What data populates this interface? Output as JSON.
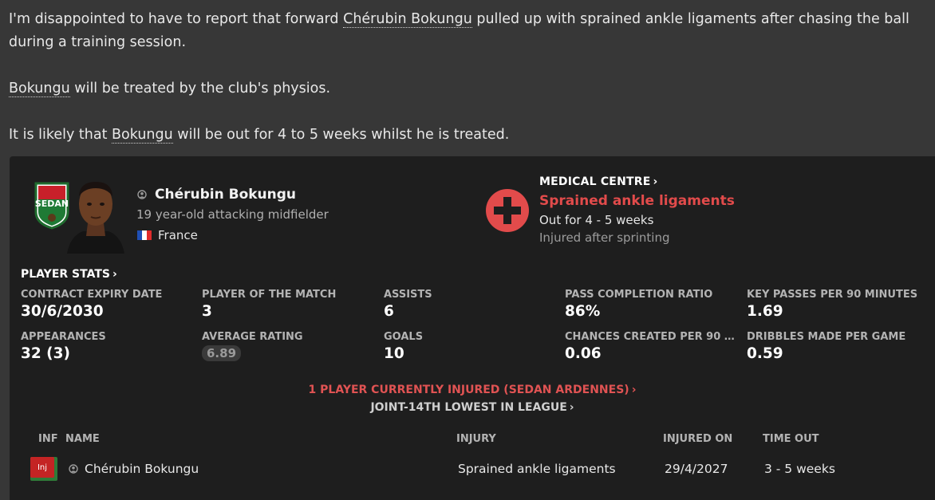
{
  "message": {
    "p1_before": "I'm disappointed to have to report that forward ",
    "p1_player": "Chérubin Bokungu",
    "p1_after": " pulled up with sprained ankle ligaments after chasing the ball during a training session.",
    "p2_player": "Bokungu",
    "p2_after": " will be treated by the club's physios.",
    "p3_before": "It is likely that ",
    "p3_player": "Bokungu",
    "p3_after": " will be out for 4 to 5 weeks whilst he is treated."
  },
  "player": {
    "name": "Chérubin Bokungu",
    "description": "19 year-old attacking midfielder",
    "nationality": "France",
    "club_badge_text": "SEDAN"
  },
  "medical": {
    "title": "MEDICAL CENTRE",
    "injury": "Sprained ankle ligaments",
    "out_for": "Out for 4 - 5 weeks",
    "cause": "Injured after sprinting"
  },
  "stats": {
    "title": "PLAYER STATS",
    "items": [
      {
        "label": "CONTRACT EXPIRY DATE",
        "value": "30/6/2030"
      },
      {
        "label": "PLAYER OF THE MATCH",
        "value": "3"
      },
      {
        "label": "ASSISTS",
        "value": "6"
      },
      {
        "label": "PASS COMPLETION RATIO",
        "value": "86%"
      },
      {
        "label": "KEY PASSES PER 90 MINUTES",
        "value": "1.69"
      },
      {
        "label": "APPEARANCES",
        "value": "32 (3)"
      },
      {
        "label": "AVERAGE RATING",
        "value": "6.89"
      },
      {
        "label": "GOALS",
        "value": "10"
      },
      {
        "label": "CHANCES CREATED PER 90 MIN...",
        "value": "0.06"
      },
      {
        "label": "DRIBBLES MADE PER GAME",
        "value": "0.59"
      }
    ]
  },
  "injury_summary": {
    "count_text": "1 PLAYER CURRENTLY INJURED (SEDAN ARDENNES)",
    "rank_text": "JOINT-14TH LOWEST IN LEAGUE"
  },
  "table": {
    "headers": {
      "inf": "INF",
      "name": "NAME",
      "injury": "INJURY",
      "injured_on": "INJURED ON",
      "time_out": "TIME OUT"
    },
    "rows": [
      {
        "inf": "Inj",
        "name": "Chérubin Bokungu",
        "injury": "Sprained ankle ligaments",
        "injured_on": "29/4/2027",
        "time_out": "3 - 5 weeks"
      }
    ]
  },
  "colors": {
    "background": "#373737",
    "card": "#1e1e1e",
    "injury_red": "#e24b4b",
    "inj_tag_red": "#c42424",
    "inj_tag_green": "#2f7a38"
  },
  "icons": [
    "person-icon",
    "medical-cross-icon",
    "chevron-right-icon",
    "france-flag-icon",
    "club-badge-icon"
  ]
}
